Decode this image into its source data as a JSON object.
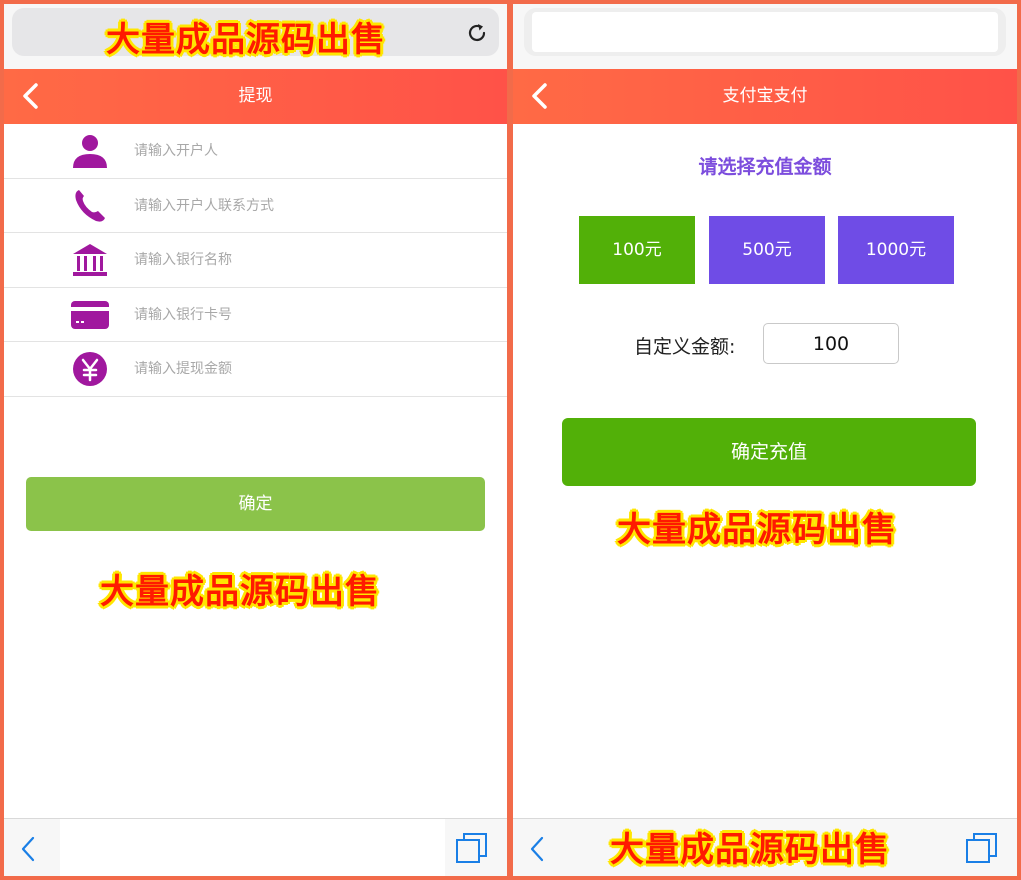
{
  "watermark_text": "大量成品源码出售",
  "left_screen": {
    "header_title": "提现",
    "fields": [
      {
        "icon": "user-icon",
        "placeholder": "请输入开户人"
      },
      {
        "icon": "phone-icon",
        "placeholder": "请输入开户人联系方式"
      },
      {
        "icon": "bank-icon",
        "placeholder": "请输入银行名称"
      },
      {
        "icon": "card-icon",
        "placeholder": "请输入银行卡号"
      },
      {
        "icon": "yen-icon",
        "placeholder": "请输入提现金额"
      }
    ],
    "confirm_label": "确定",
    "icon_color": "#a0189e",
    "confirm_color": "#8bc34a"
  },
  "right_screen": {
    "header_title": "支付宝支付",
    "prompt": "请选择充值金额",
    "amount_options": [
      {
        "label": "100元",
        "selected": true
      },
      {
        "label": "500元",
        "selected": false
      },
      {
        "label": "1000元",
        "selected": false
      }
    ],
    "custom_amount_label": "自定义金额:",
    "custom_amount_value": "100",
    "confirm_label": "确定充值",
    "selected_color": "#52b008",
    "option_color": "#6f4ce6"
  },
  "colors": {
    "frame": "#f26b4a",
    "header_start": "#ff6a45",
    "header_end": "#ff5248",
    "watermark_fill": "#ff1a00",
    "watermark_outline": "#ffe600",
    "browser_blue": "#1a7fe6"
  }
}
